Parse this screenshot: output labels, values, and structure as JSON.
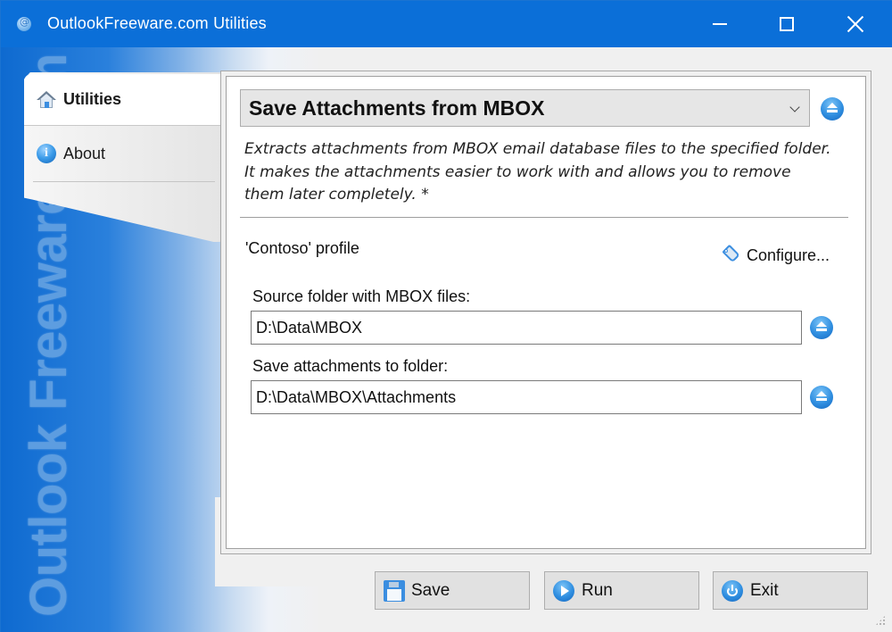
{
  "window": {
    "title": "OutlookFreeware.com Utilities",
    "controls": {
      "minimize": "minimize-icon",
      "maximize": "maximize-icon",
      "close": "close-icon"
    },
    "accent_color": "#0b6fd8"
  },
  "banner": {
    "text": "Outlook Freeware .com"
  },
  "nav": {
    "items": [
      {
        "label": "Utilities",
        "icon": "home-icon",
        "active": true
      },
      {
        "label": "About",
        "icon": "info-icon",
        "active": false
      }
    ]
  },
  "main": {
    "utility_selected": "Save Attachments from MBOX",
    "description": "Extracts attachments from MBOX email database files to the specified folder. It makes the attachments easier to work with and allows you to remove them later completely. *",
    "profile": "'Contoso' profile",
    "configure_label": "Configure...",
    "fields": [
      {
        "label": "Source folder with MBOX files:",
        "value": "D:\\Data\\MBOX"
      },
      {
        "label": "Save attachments to folder:",
        "value": "D:\\Data\\MBOX\\Attachments"
      }
    ]
  },
  "buttons": {
    "save": "Save",
    "run": "Run",
    "exit": "Exit"
  }
}
